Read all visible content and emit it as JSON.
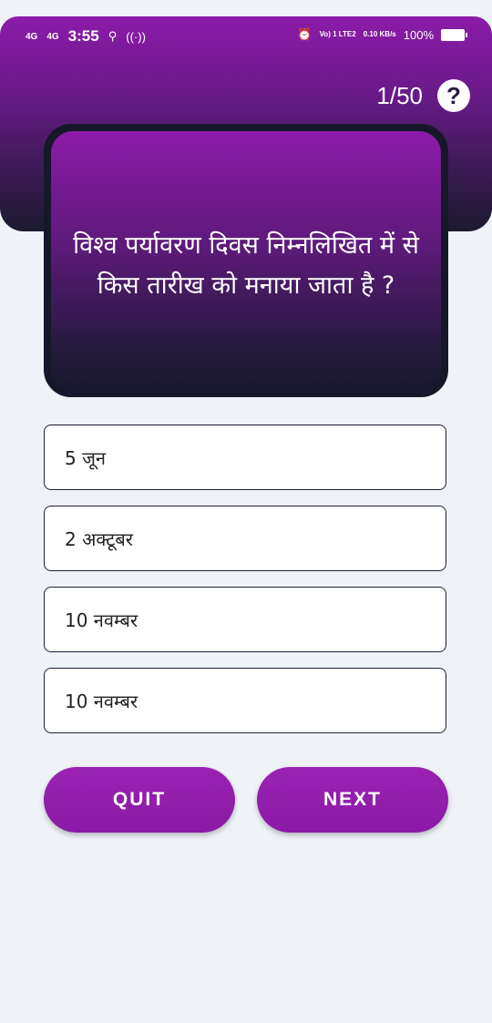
{
  "status_bar": {
    "net1": "4G",
    "net2": "4G",
    "time": "3:55",
    "volte": "Vo) 1 LTE2",
    "speed": "0.10 KB/s",
    "battery": "100%"
  },
  "quiz": {
    "counter": "1/50",
    "help_symbol": "?",
    "question": "विश्व पर्यावरण दिवस निम्नलिखित में से किस तारीख को मनाया जाता है ?",
    "options": [
      "5 जून",
      "2 अक्टूबर",
      "10 नवम्बर",
      "10 नवम्बर"
    ]
  },
  "buttons": {
    "quit": "QUIT",
    "next": "NEXT"
  },
  "colors": {
    "accent": "#8c1ba8",
    "dark": "#16182a",
    "background": "#eff3f8"
  }
}
